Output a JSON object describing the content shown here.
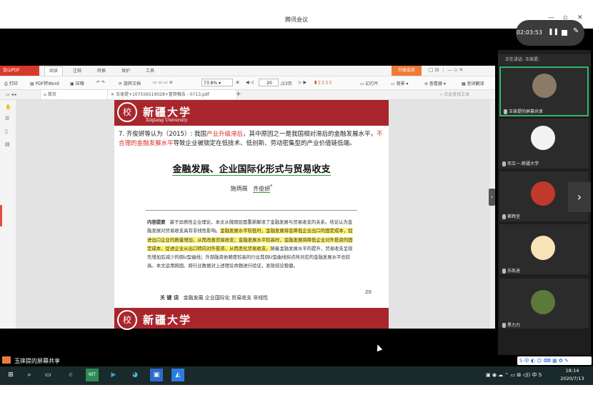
{
  "meeting": {
    "title": "腾讯会议",
    "timer": "02:03:53",
    "speaking": "正在讲话: 玉徕提;",
    "share_status": "玉徕提的屏幕共享",
    "participants": [
      {
        "name": "玉徕提的屏幕共享"
      },
      {
        "name": "邓又一-新疆大学"
      },
      {
        "name": "崔辉坐"
      },
      {
        "name": "乐凯迪"
      },
      {
        "name": "黑力力"
      }
    ]
  },
  "pdf_app": {
    "logo": "金山PDF",
    "menu_tabs": [
      "阅读",
      "注释",
      "转换",
      "保护",
      "工具"
    ],
    "promo": "升级会员",
    "tools": [
      "打印",
      "PDF转Word",
      "压缩",
      "旋转文档"
    ],
    "zoom": "73.8%",
    "page_current": "20",
    "page_total": "/23页",
    "right_tools": [
      "幻灯片",
      "背景",
      "查看器",
      "划词翻译"
    ],
    "search_placeholder": "点此查找文本",
    "doc_tabs": [
      "首页",
      "玉徕提+107556519028+書賀報告 - 0713.pdf"
    ]
  },
  "document": {
    "university_cn": "新疆大学",
    "university_en": "Xinjiang University",
    "para_prefix": "7. 齐俊妍等认为（2015）: 我国",
    "para_red1": "产业升级滞后",
    "para_mid": "，其中原因之一是我国相对滞后的金融发展水平，",
    "para_red2": "不合理的金融发展水平",
    "para_suffix": "导致企业被锁定在低技术、低创新、劳动密集型的产业价值链低端。",
    "paper_title": "金融发展、企业国际化形式与贸易收支",
    "authors_a": "施炳展",
    "authors_b": "齐俊妍",
    "abstract_label": "内容提要",
    "abstract_1": "基于异质性企业理论，本文从微观层面重新解读了金融发展与贸易收支的关系。结论认为金融发展对贸易收支具有非线性影响。",
    "abstract_hl": "金融发展水平较低时，金融发展将会降低企业出口的固定成本，促进出口企业的数量增加，从而改善贸易收支；金融发展水平较高时，金融发展将降低企业对外投资的固定成本，促进企业从出口转向对外投资，从而恶化贸易收支。",
    "abstract_2": "随着金融发展水平的提升，贸易收支呈现先增加后减少的倒U型曲线；外部融资依赖度较高的行业其倒U型曲线拐点所对应的金融发展水平也较高。本文运用跨国、跨行业数据对上述理论命题进行验证，发现结论稳健。",
    "keywords_label": "关 键 词",
    "keywords": "金融发展  企业国际化  贸易收支  非线性",
    "page_number": "20"
  },
  "taskbar": {
    "time": "18:14",
    "date": "2020/7/13",
    "ime": "中"
  },
  "colors": {
    "banner": "#a9262d",
    "highlight": "#fff36a",
    "accent": "#f07b37"
  }
}
